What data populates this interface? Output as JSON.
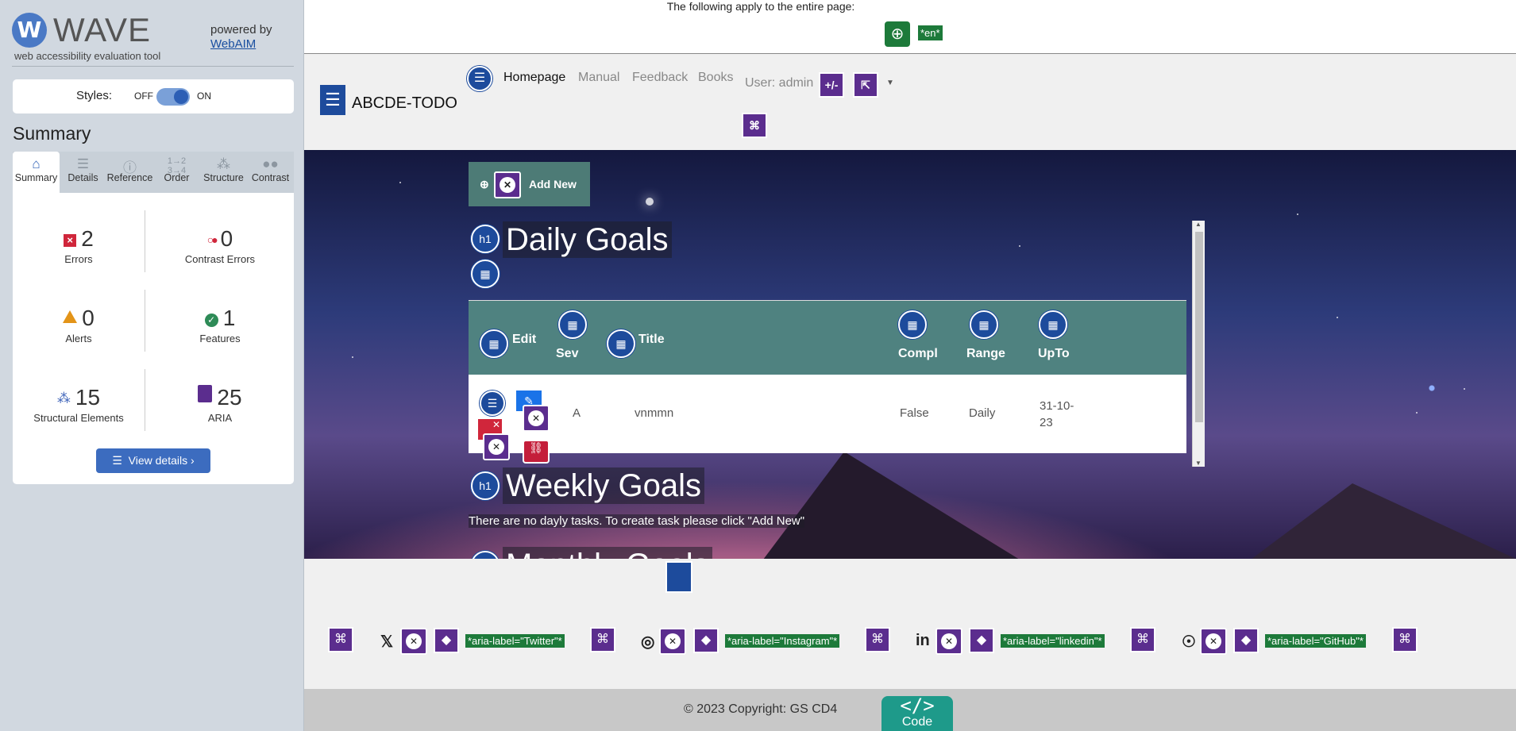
{
  "wave": {
    "logo_letter": "W",
    "name": "WAVE",
    "tagline": "web accessibility evaluation tool",
    "powered_by": "powered by",
    "powered_link": "WebAIM",
    "styles_label": "Styles:",
    "styles_off": "OFF",
    "styles_on": "ON",
    "summary_title": "Summary",
    "tabs": [
      {
        "label": "Summary",
        "icon": "home-icon"
      },
      {
        "label": "Details",
        "icon": "list-icon"
      },
      {
        "label": "Reference",
        "icon": "info-icon"
      },
      {
        "label": "Order",
        "icon": "order-icon"
      },
      {
        "label": "Structure",
        "icon": "structure-icon"
      },
      {
        "label": "Contrast",
        "icon": "contrast-icon"
      }
    ],
    "stats": {
      "errors": {
        "value": "2",
        "label": "Errors"
      },
      "contrast": {
        "value": "0",
        "label": "Contrast Errors"
      },
      "alerts": {
        "value": "0",
        "label": "Alerts"
      },
      "features": {
        "value": "1",
        "label": "Features"
      },
      "structure": {
        "value": "15",
        "label": "Structural Elements"
      },
      "aria": {
        "value": "25",
        "label": "ARIA"
      }
    },
    "view_details": "View details ›"
  },
  "page": {
    "banner": "The following apply to the entire page:",
    "lang": "*en*",
    "brand": "ABCDE-TODO",
    "nav": [
      "Homepage",
      "Manual",
      "Feedback",
      "Books"
    ],
    "user": "User: admin",
    "plusminus": "+/-",
    "add_new": "Add New",
    "daily_title": "Daily Goals",
    "weekly_title": "Weekly Goals",
    "monthly_title": "Monthly Goals",
    "empty_msg": "There are no dayly tasks. To create task please click \"Add New\"",
    "table": {
      "headers": [
        "Edit",
        "Sev",
        "Title",
        "Compl",
        "Range",
        "UpTo"
      ],
      "row": {
        "sev": "A",
        "title": "vnmmn",
        "compl": "False",
        "range": "Daily",
        "upto": "31-10-23"
      }
    },
    "social_labels": [
      "*aria-label=\"Twitter\"*",
      "*aria-label=\"Instagram\"*",
      "*aria-label=\"linkedin\"*",
      "*aria-label=\"GitHub\"*"
    ],
    "copyright": "© 2023 Copyright: GS CD4",
    "code_glyph": "</>",
    "code_label": "Code"
  },
  "colors": {
    "wave_blue": "#2d5fb5",
    "error_red": "#d0263b",
    "alert_orange": "#e39418",
    "feature_green": "#2e8b57",
    "aria_purple": "#5b2d8e",
    "badge_green": "#1d7a3a",
    "table_header_teal": "#4f8280"
  }
}
